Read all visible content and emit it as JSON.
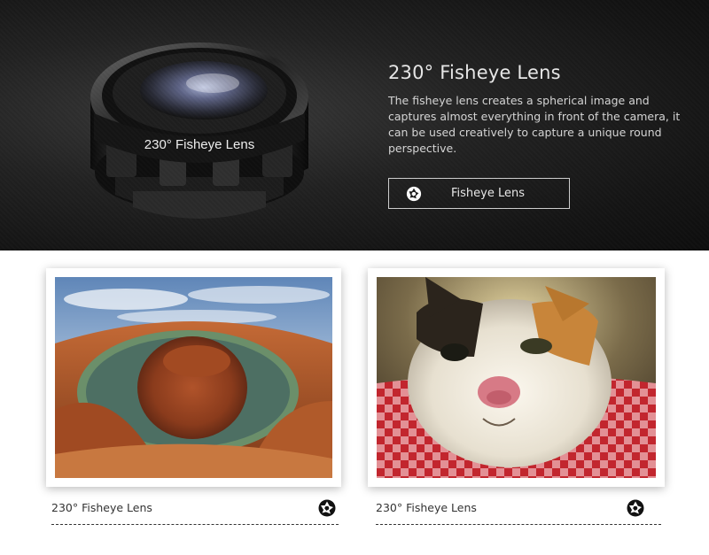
{
  "hero": {
    "title": "230° Fisheye Lens",
    "description": "The fisheye lens creates a spherical image and captures almost everything in front of the camera, it can be used creatively to capture a unique round perspective.",
    "button_label": "Fisheye Lens",
    "button_icon": "aperture-icon",
    "lens_engraving": "230°  Fisheye  Lens"
  },
  "gallery": [
    {
      "caption": "230° Fisheye Lens",
      "image": "canyon-fisheye-photo",
      "icon": "aperture-icon"
    },
    {
      "caption": "230° Fisheye Lens",
      "image": "cat-fisheye-photo",
      "icon": "aperture-icon"
    }
  ],
  "colors": {
    "hero_bg": "#1a1a1a",
    "hero_text": "#e8e8e8",
    "caption_text": "#333333"
  }
}
